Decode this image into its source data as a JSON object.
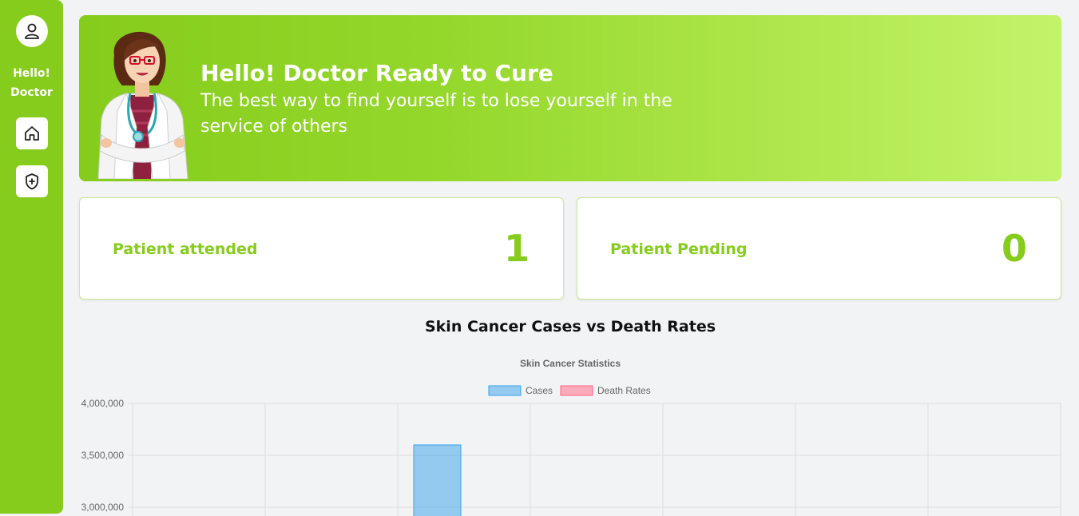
{
  "sidebar": {
    "greeting_line1": "Hello!",
    "greeting_line2": "Doctor",
    "nav_items": [
      {
        "icon": "home-icon"
      },
      {
        "icon": "shield-plus-icon"
      }
    ],
    "accent_color": "#86cc1c"
  },
  "banner": {
    "title": "Hello! Doctor Ready to Cure",
    "quote": "The best way to find yourself is to lose yourself in the service of others"
  },
  "stats": {
    "attended": {
      "label": "Patient attended",
      "value": "1"
    },
    "pending": {
      "label": "Patient Pending",
      "value": "0"
    }
  },
  "chart_section": {
    "heading": "Skin Cancer Cases vs Death Rates"
  },
  "chart_data": {
    "type": "bar",
    "title": "Skin Cancer Statistics",
    "categories": [
      "",
      "",
      "",
      "",
      "",
      "",
      ""
    ],
    "series": [
      {
        "name": "Cases",
        "color": "#36a2eb",
        "values": [
          null,
          null,
          3600000,
          null,
          null,
          null,
          null
        ]
      },
      {
        "name": "Death Rates",
        "color": "#ff6384",
        "values": [
          null,
          null,
          null,
          null,
          null,
          null,
          null
        ]
      }
    ],
    "y_ticks": [
      "4,000,000",
      "3,500,000",
      "3,000,000"
    ],
    "ylim": [
      3000000,
      4000000
    ],
    "legend": "top",
    "grid": true
  }
}
